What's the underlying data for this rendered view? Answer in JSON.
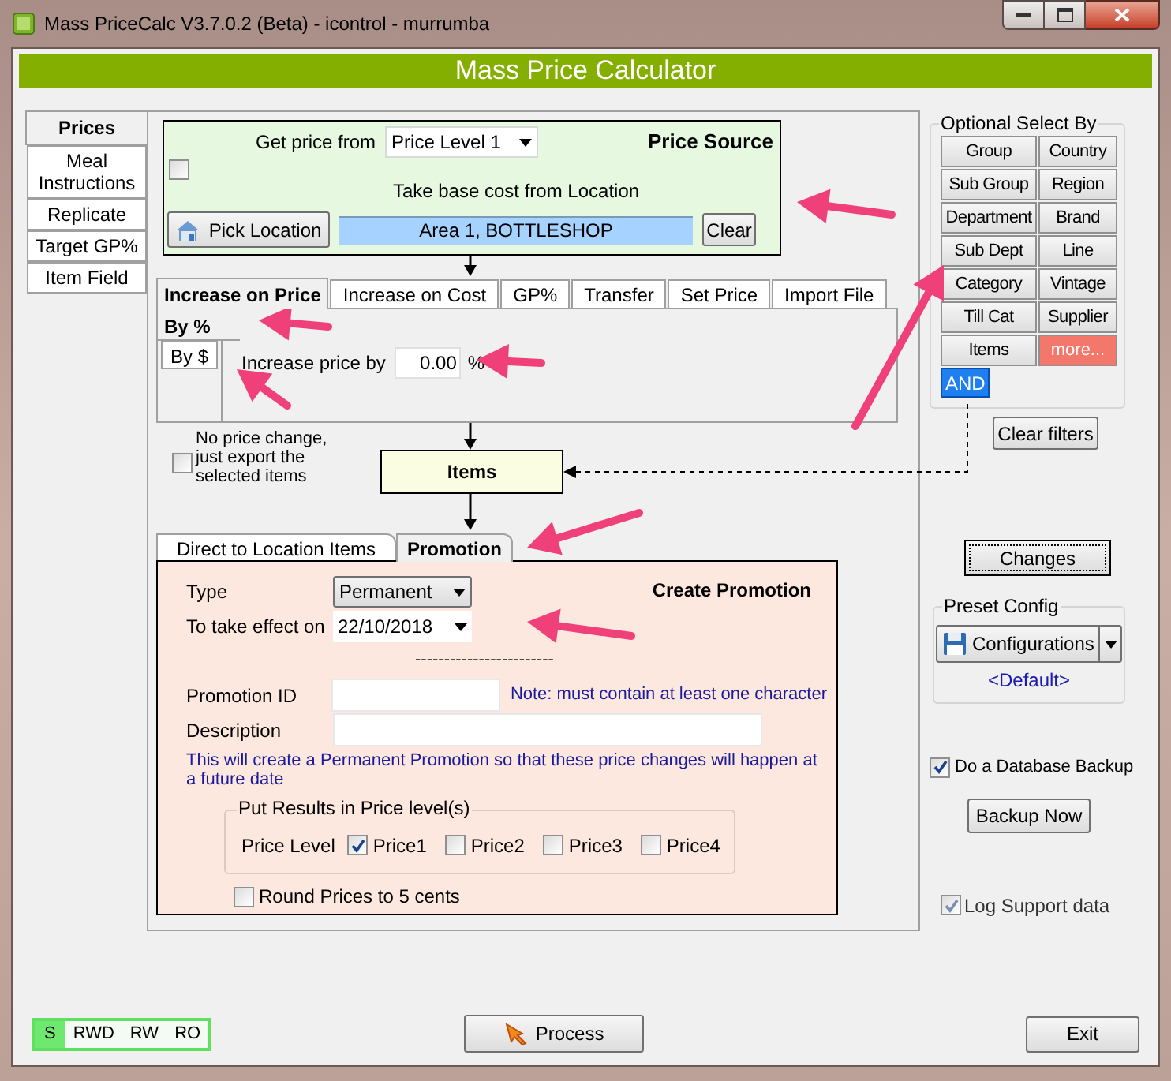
{
  "window": {
    "title": "Mass PriceCalc V3.7.0.2 (Beta) - icontrol - murrumba"
  },
  "header": "Mass Price Calculator",
  "side_tabs": [
    {
      "label": "Prices",
      "selected": true
    },
    {
      "label": "Meal Instructions",
      "selected": false
    },
    {
      "label": "Replicate",
      "selected": false
    },
    {
      "label": "Target GP%",
      "selected": false
    },
    {
      "label": "Item Field",
      "selected": false
    }
  ],
  "price_source": {
    "title": "Price Source",
    "get_price_label": "Get price from",
    "price_level": "Price Level 1",
    "checked": false,
    "location_label": "Take base cost from Location",
    "pick_button": "Pick Location",
    "location": "Area 1, BOTTLESHOP",
    "clear_button": "Clear"
  },
  "method_tabs": [
    {
      "label": "Increase on Price",
      "selected": true
    },
    {
      "label": "Increase on Cost",
      "selected": false
    },
    {
      "label": "GP%",
      "selected": false
    },
    {
      "label": "Transfer",
      "selected": false
    },
    {
      "label": "Set Price",
      "selected": false
    },
    {
      "label": "Import File",
      "selected": false
    }
  ],
  "sub_tabs": [
    {
      "label": "By %",
      "selected": true
    },
    {
      "label": "By $",
      "selected": false
    }
  ],
  "increase": {
    "label": "Increase price by",
    "value": "0.00",
    "unit": "%"
  },
  "no_price_change": {
    "label": "No price change, just export the selected items",
    "checked": false
  },
  "items_box": "Items",
  "output_tabs": [
    {
      "label": "Direct to Location Items",
      "selected": false
    },
    {
      "label": "Promotion",
      "selected": true
    }
  ],
  "promotion": {
    "title": "Create Promotion",
    "type_label": "Type",
    "type": "Permanent",
    "date_label": "To take effect on",
    "date": "22/10/2018",
    "separator": "------------------------",
    "id_label": "Promotion ID",
    "note": "Note: must contain at least one character",
    "description_label": "Description",
    "info": "This will create a Permanent Promotion so that these price changes will happen at a future date",
    "results_group": "Put Results in Price level(s)",
    "price_level_label": "Price Level",
    "price_levels": [
      {
        "label": "Price1",
        "checked": true
      },
      {
        "label": "Price2",
        "checked": false
      },
      {
        "label": "Price3",
        "checked": false
      },
      {
        "label": "Price4",
        "checked": false
      }
    ],
    "round": {
      "label": "Round Prices to 5 cents",
      "checked": false
    }
  },
  "select_by": {
    "title": "Optional Select By",
    "buttons": [
      {
        "label": "Group",
        "kind": "normal"
      },
      {
        "label": "Country",
        "kind": "normal"
      },
      {
        "label": "Sub Group",
        "kind": "normal"
      },
      {
        "label": "Region",
        "kind": "normal"
      },
      {
        "label": "Department",
        "kind": "normal"
      },
      {
        "label": "Brand",
        "kind": "normal"
      },
      {
        "label": "Sub Dept",
        "kind": "normal"
      },
      {
        "label": "Line",
        "kind": "normal"
      },
      {
        "label": "Category",
        "kind": "normal"
      },
      {
        "label": "Vintage",
        "kind": "normal"
      },
      {
        "label": "Till Cat",
        "kind": "normal"
      },
      {
        "label": "Supplier",
        "kind": "normal"
      },
      {
        "label": "Items",
        "kind": "normal"
      },
      {
        "label": "more...",
        "kind": "more"
      }
    ],
    "and_button": "AND",
    "clear_button": "Clear filters"
  },
  "changes_button": "Changes",
  "preset": {
    "title": "Preset Config",
    "button": "Configurations",
    "current": "<Default>"
  },
  "backup": {
    "label": "Do a Database Backup",
    "checked": true,
    "button": "Backup Now"
  },
  "log_support": {
    "label": "Log Support data",
    "checked": true,
    "disabled": true
  },
  "access_modes": [
    {
      "label": "S",
      "selected": true
    },
    {
      "label": "RWD",
      "selected": false
    },
    {
      "label": "RW",
      "selected": false
    },
    {
      "label": "RO",
      "selected": false
    }
  ],
  "process_button": "Process",
  "exit_button": "Exit"
}
